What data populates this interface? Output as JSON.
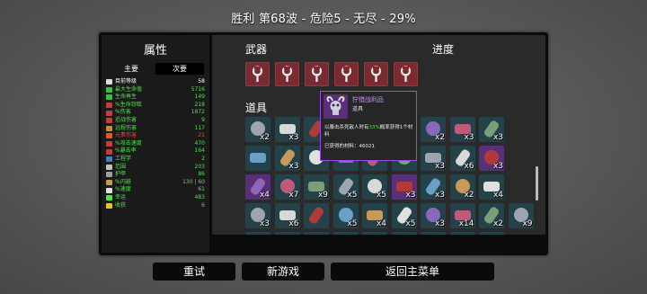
{
  "header": {
    "title": "胜利   第68波 - 危险5 - 无尽 - 29%"
  },
  "stats_panel": {
    "title": "属性",
    "tabs": [
      {
        "label": "主要"
      },
      {
        "label": "次要"
      }
    ],
    "rows": [
      {
        "name": "目前等级",
        "value": "58",
        "color": "#ffffff",
        "icon": "level-icon",
        "icon_color": "#dcdcdc"
      },
      {
        "name": "最大生命值",
        "value": "5716",
        "color": "#4fe34f",
        "icon": "heart-icon",
        "icon_color": "#3cc03c"
      },
      {
        "name": "生命再生",
        "value": "149",
        "color": "#4fe34f",
        "icon": "regen-icon",
        "icon_color": "#3cc03c"
      },
      {
        "name": "%生命窃取",
        "value": "218",
        "color": "#4fe34f",
        "icon": "lifesteal-icon",
        "icon_color": "#c04040"
      },
      {
        "name": "%伤害",
        "value": "1872",
        "color": "#4fe34f",
        "icon": "damage-icon",
        "icon_color": "#c04040"
      },
      {
        "name": "近战伤害",
        "value": "9",
        "color": "#4fe34f",
        "icon": "melee-icon",
        "icon_color": "#c04040"
      },
      {
        "name": "远程伤害",
        "value": "117",
        "color": "#4fe34f",
        "icon": "ranged-icon",
        "icon_color": "#c08a40"
      },
      {
        "name": "元素伤害",
        "value": "-21",
        "color": "#ff3b3b",
        "icon": "elemental-icon",
        "icon_color": "#e05a20"
      },
      {
        "name": "%攻击速度",
        "value": "470",
        "color": "#4fe34f",
        "icon": "attack-speed-icon",
        "icon_color": "#c04040"
      },
      {
        "name": "%暴击率",
        "value": "164",
        "color": "#4fe34f",
        "icon": "crit-icon",
        "icon_color": "#c04040"
      },
      {
        "name": "工程学",
        "value": "2",
        "color": "#4fe34f",
        "icon": "engineering-icon",
        "icon_color": "#4080c0"
      },
      {
        "name": "范围",
        "value": "203",
        "color": "#4fe34f",
        "icon": "range-icon",
        "icon_color": "#c0c0c0"
      },
      {
        "name": "护甲",
        "value": "86",
        "color": "#4fe34f",
        "icon": "armor-icon",
        "icon_color": "#a0a0a0"
      },
      {
        "name": "%闪避",
        "value": "130 | 60",
        "color": "#4fe34f",
        "icon": "dodge-icon",
        "icon_color": "#c0a040"
      },
      {
        "name": "%速度",
        "value": "61",
        "color": "#4fe34f",
        "icon": "speed-icon",
        "icon_color": "#e0e0e0"
      },
      {
        "name": "幸运",
        "value": "483",
        "color": "#4fe34f",
        "icon": "luck-icon",
        "icon_color": "#4fe34f"
      },
      {
        "name": "收获",
        "value": "6",
        "color": "#4fe34f",
        "icon": "harvest-icon",
        "icon_color": "#e0c040"
      }
    ]
  },
  "weapons": {
    "title": "武器",
    "count": 6,
    "icon": "wrench-icon",
    "slot_color": "#7a2a30"
  },
  "progress": {
    "title": "进度"
  },
  "items": {
    "title": "道具",
    "rows": [
      [
        {
          "q": "x2",
          "bg": "#24424a",
          "icon": "crate-icon"
        },
        {
          "q": "x3",
          "bg": "#24424a",
          "icon": "dna-icon"
        },
        {
          "q": "",
          "bg": "#24424a",
          "icon": "bag-icon"
        },
        {
          "q": "",
          "bg": "#24424a",
          "icon": "item-icon"
        },
        {
          "q": "",
          "bg": "#24424a",
          "icon": "item-icon"
        },
        {
          "q": "",
          "bg": "#24424a",
          "icon": "item-icon"
        },
        {
          "q": "x2",
          "bg": "#24424a",
          "icon": "tools-icon"
        },
        {
          "q": "x3",
          "bg": "#24424a",
          "icon": "boot-icon"
        },
        {
          "q": "x3",
          "bg": "#24424a",
          "icon": "ring-icon"
        }
      ],
      [
        {
          "q": "",
          "bg": "#24424a",
          "icon": "turret-icon"
        },
        {
          "q": "x3",
          "bg": "#24424a",
          "icon": "alien-eyes-icon"
        },
        {
          "q": "",
          "bg": "#24424a",
          "icon": "item-icon"
        },
        {
          "q": "",
          "bg": "#24424a",
          "icon": "item-icon"
        },
        {
          "q": "",
          "bg": "#24424a",
          "icon": "item-icon"
        },
        {
          "q": "",
          "bg": "#24424a",
          "icon": "item-icon"
        },
        {
          "q": "x3",
          "bg": "#24424a",
          "icon": "meat-icon"
        },
        {
          "q": "x6",
          "bg": "#24424a",
          "icon": "gem-icon"
        },
        {
          "q": "x3",
          "bg": "#5a2f7a",
          "icon": "spider-icon"
        }
      ],
      [
        {
          "q": "x4",
          "bg": "#5a2f7a",
          "icon": "claw-icon"
        },
        {
          "q": "x7",
          "bg": "#24424a",
          "icon": "bone-icon"
        },
        {
          "q": "x9",
          "bg": "#24424a",
          "icon": "stick-icon"
        },
        {
          "q": "x5",
          "bg": "#24424a",
          "icon": "ghost-icon"
        },
        {
          "q": "x5",
          "bg": "#24424a",
          "icon": "robot-icon"
        },
        {
          "q": "x3",
          "bg": "#5a2f7a",
          "icon": "ram-skull-icon"
        },
        {
          "q": "x3",
          "bg": "#24424a",
          "icon": "bottle-icon"
        },
        {
          "q": "x2",
          "bg": "#24424a",
          "icon": "sausage-icon"
        },
        {
          "q": "x4",
          "bg": "#24424a",
          "icon": "potion-icon"
        }
      ],
      [
        {
          "q": "x3",
          "bg": "#24424a",
          "icon": "skull-icon"
        },
        {
          "q": "x6",
          "bg": "#24424a",
          "icon": "bug-icon"
        },
        {
          "q": "",
          "bg": "#24424a",
          "icon": "bomb-icon"
        },
        {
          "q": "x5",
          "bg": "#24424a",
          "icon": "scarf-icon"
        },
        {
          "q": "x4",
          "bg": "#24424a",
          "icon": "tentacle-icon"
        },
        {
          "q": "x5",
          "bg": "#24424a",
          "icon": "bat-icon"
        },
        {
          "q": "x3",
          "bg": "#24424a",
          "icon": "ghost-hand-icon"
        },
        {
          "q": "x14",
          "bg": "#24424a",
          "icon": "frog-icon"
        },
        {
          "q": "x2",
          "bg": "#24424a",
          "icon": "horn-icon"
        },
        {
          "q": "x9",
          "bg": "#24424a",
          "icon": "toaster-icon"
        }
      ],
      [
        {
          "q": "",
          "bg": "#24424a",
          "icon": "pink-blob-icon"
        },
        {
          "q": "",
          "bg": "#24424a",
          "icon": "item-icon"
        },
        {
          "q": "",
          "bg": "#24424a",
          "icon": "item-icon"
        },
        {
          "q": "",
          "bg": "#24424a",
          "icon": "item-icon"
        },
        {
          "q": "",
          "bg": "#24424a",
          "icon": "item-icon"
        },
        {
          "q": "",
          "bg": "#24424a",
          "icon": "item-icon"
        },
        {
          "q": "",
          "bg": "#24424a",
          "icon": "item-icon"
        },
        {
          "q": "",
          "bg": "#24424a",
          "icon": "item-icon"
        },
        {
          "q": "",
          "bg": "#24424a",
          "icon": "item-icon"
        }
      ]
    ]
  },
  "tooltip": {
    "name": "狞猎战利品",
    "type": "道具",
    "desc_pre": "以暴击杀死敌人时有",
    "desc_highlight": "33%",
    "desc_post": "概率获得1个材料",
    "collected": "已获得的材料：46021"
  },
  "buttons": {
    "retry": "重试",
    "new_game": "新游戏",
    "main_menu": "返回主菜单"
  }
}
